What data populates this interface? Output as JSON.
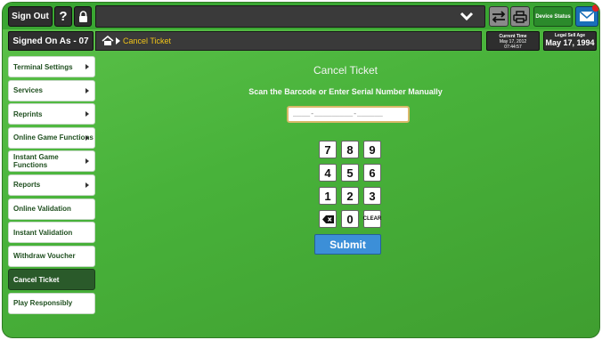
{
  "header": {
    "sign_out_label": "Sign Out",
    "help_label": "?",
    "device_status_label": "Device Status",
    "icons": [
      "lock-icon",
      "chevron-down-icon",
      "transfer-icon",
      "printer-icon",
      "mail-icon"
    ]
  },
  "status_row": {
    "signed_on": "Signed On As - 07",
    "breadcrumb": "Cancel Ticket",
    "current_time_label": "Current Time",
    "current_time_date": "May 17, 2012",
    "current_time_clock": "07:44:57",
    "legal_age_label": "Legal Sell Age",
    "legal_age_value": "May 17, 1994"
  },
  "sidebar": {
    "items": [
      {
        "label": "Terminal Settings",
        "has_arrow": true
      },
      {
        "label": "Services",
        "has_arrow": true
      },
      {
        "label": "Reprints",
        "has_arrow": true
      },
      {
        "label": "Online Game Functions",
        "has_arrow": true
      },
      {
        "label": "Instant Game Functions",
        "has_arrow": true
      },
      {
        "label": "Reports",
        "has_arrow": true
      },
      {
        "label": "Online Validation",
        "has_arrow": false
      },
      {
        "label": "Instant Validation",
        "has_arrow": false
      },
      {
        "label": "Withdraw Voucher",
        "has_arrow": false
      },
      {
        "label": "Cancel Ticket",
        "has_arrow": false,
        "active": true
      },
      {
        "label": "Play Responsibly",
        "has_arrow": false
      }
    ]
  },
  "main": {
    "title": "Cancel Ticket",
    "instruction": "Scan the Barcode or Enter Serial Number Manually",
    "serial_placeholder": "____-_________-______",
    "keypad": [
      "7",
      "8",
      "9",
      "4",
      "5",
      "6",
      "1",
      "2",
      "3",
      "0",
      "CLEAR"
    ],
    "submit_label": "Submit"
  },
  "colors": {
    "background_green": "#48b23a",
    "breadcrumb_text": "#f0c419",
    "submit_blue": "#3c8fd8",
    "active_item": "#2a5a2a"
  }
}
